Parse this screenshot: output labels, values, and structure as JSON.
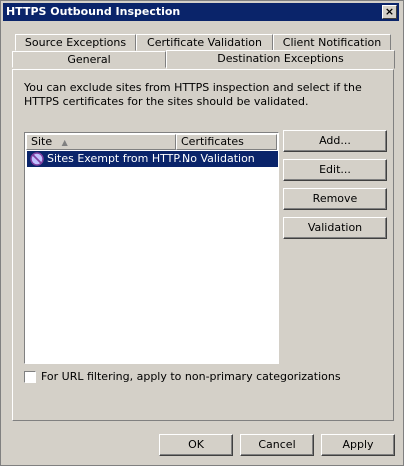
{
  "window": {
    "title": "HTTPS Outbound Inspection",
    "close_glyph": "×"
  },
  "tabs_row1": [
    "Source Exceptions",
    "Certificate Validation",
    "Client Notification"
  ],
  "tabs_row2": [
    "General",
    "Destination Exceptions"
  ],
  "description": "You can exclude sites from HTTPS inspection and select if the HTTPS certificates for the sites should be validated.",
  "list": {
    "columns": [
      "Site",
      "Certificates"
    ],
    "rows": [
      {
        "site": "Sites Exempt from HTTP...",
        "certificates": "No Validation",
        "icon": "blocked-circle-icon"
      }
    ]
  },
  "side_buttons": {
    "add": "Add...",
    "edit": "Edit...",
    "remove": "Remove",
    "validation": "Validation"
  },
  "checkbox": {
    "label": "For URL filtering, apply to non-primary categorizations",
    "checked": false
  },
  "footer_buttons": {
    "ok": "OK",
    "cancel": "Cancel",
    "apply": "Apply"
  },
  "colors": {
    "titlebar": "#0a246a",
    "selection": "#0a246a",
    "dialog": "#d4d0c8"
  }
}
